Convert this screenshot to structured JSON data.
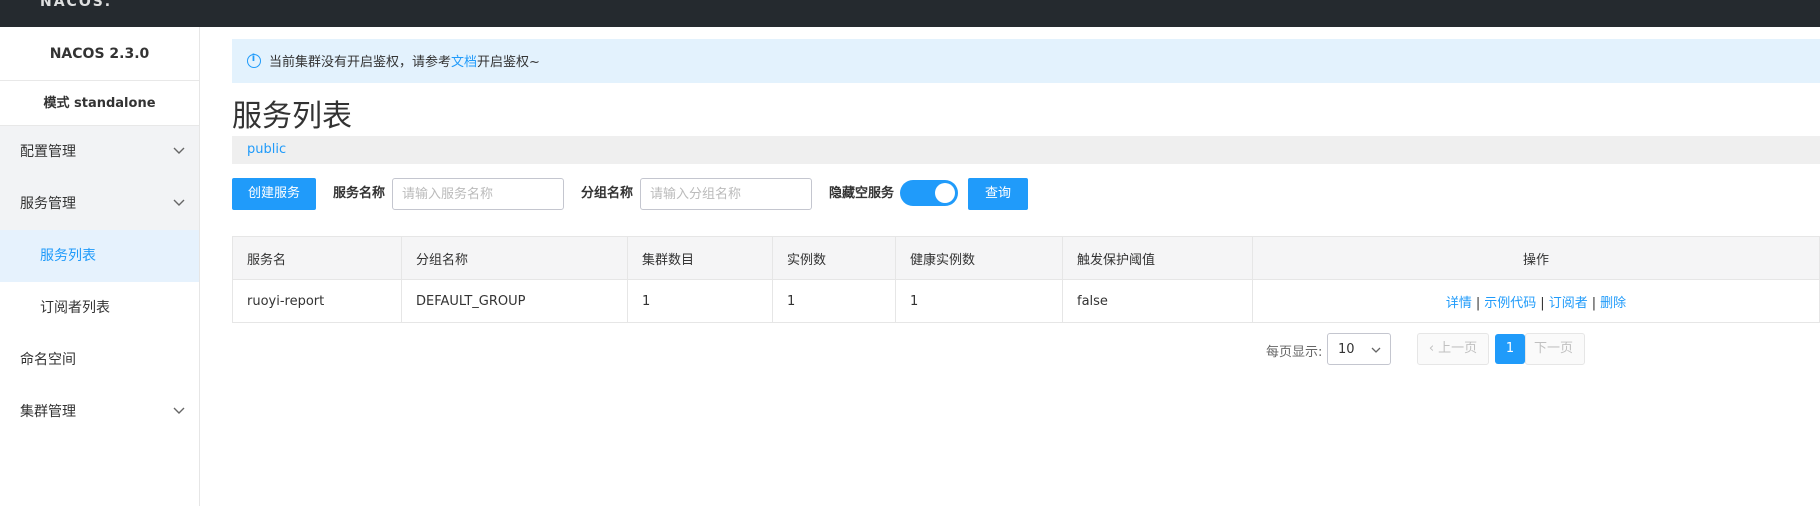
{
  "topbar": {
    "logo": "NACOS."
  },
  "sidebar": {
    "version": "NACOS 2.3.0",
    "mode": "模式 standalone",
    "items": [
      {
        "label": "配置管理"
      },
      {
        "label": "服务管理"
      },
      {
        "label": "服务列表"
      },
      {
        "label": "订阅者列表"
      },
      {
        "label": "命名空间"
      },
      {
        "label": "集群管理"
      }
    ]
  },
  "notice": {
    "prefix": "当前集群没有开启鉴权，请参考",
    "link": "文档",
    "suffix": "开启鉴权~"
  },
  "page": {
    "title": "服务列表",
    "namespace": "public"
  },
  "toolbar": {
    "create_label": "创建服务",
    "service_name_label": "服务名称",
    "service_name_placeholder": "请输入服务名称",
    "group_name_label": "分组名称",
    "group_name_placeholder": "请输入分组名称",
    "hide_empty_label": "隐藏空服务",
    "hide_empty_on": true,
    "query_label": "查询"
  },
  "table": {
    "headers": [
      "服务名",
      "分组名称",
      "集群数目",
      "实例数",
      "健康实例数",
      "触发保护阈值",
      "操作"
    ],
    "rows": [
      {
        "service": "ruoyi-report",
        "group": "DEFAULT_GROUP",
        "clusters": "1",
        "instances": "1",
        "healthy": "1",
        "protect": "false",
        "ops": [
          "详情",
          "示例代码",
          "订阅者",
          "删除"
        ]
      }
    ],
    "sep": "|"
  },
  "pager": {
    "page_size_label": "每页显示:",
    "page_size": "10",
    "prev": "上一页",
    "current": "1",
    "next": "下一页"
  },
  "colors": {
    "accent": "#209bfa",
    "topbar": "#252a2f",
    "active_bg": "#e6f2fd"
  }
}
